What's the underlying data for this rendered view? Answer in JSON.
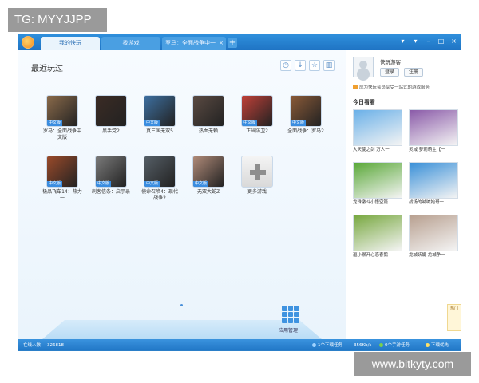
{
  "overlay": {
    "text": "TG: MYYJJPP"
  },
  "watermark": {
    "text": "www.bitkyty.com"
  },
  "titlebar": {
    "tabs": [
      {
        "label": "我的快玩"
      },
      {
        "label": "找游戏"
      },
      {
        "label": "罗马：全面战争中一"
      }
    ],
    "tab_close": "×",
    "tab_plus": "+"
  },
  "main": {
    "title": "最近玩过",
    "games": [
      {
        "name": "罗马：全面战争中文版",
        "tag": "中文版",
        "color": "#8a6a4a"
      },
      {
        "name": "黑手党2",
        "tag": "",
        "color": "#3b2b24"
      },
      {
        "name": "真三国无双5",
        "tag": "中文版",
        "color": "#3d6fa0"
      },
      {
        "name": "热血无赖",
        "tag": "",
        "color": "#5a4a42"
      },
      {
        "name": "正当防卫2",
        "tag": "中文版",
        "color": "#c04038"
      },
      {
        "name": "全面战争：罗马2",
        "tag": "中文版",
        "color": "#8a5a38"
      },
      {
        "name": "极品飞车14：热力一",
        "tag": "中文版",
        "color": "#9a4a2a"
      },
      {
        "name": "刺客信条：启示录",
        "tag": "中文版",
        "color": "#7a7a7a"
      },
      {
        "name": "使命召唤4：现代战争2",
        "tag": "中文版",
        "color": "#555e66"
      },
      {
        "name": "无双大蛇Z",
        "tag": "中文版",
        "color": "#b08a78"
      }
    ],
    "more_label": "更多游戏",
    "app_manager_label": "应用管理"
  },
  "side": {
    "user_name": "快玩游客",
    "login_label": "登录",
    "register_label": "注册",
    "promo_text": "成为快玩会员享受一站式的游戏服务",
    "today_title": "今日看看",
    "recommendations": [
      {
        "caption": "大天使之剑  万人一",
        "color": "#6ab0e8"
      },
      {
        "caption": "灵域  萝莉萌主【一",
        "color": "#8a5aa8"
      },
      {
        "caption": "龙珠激斗小悟空篇",
        "color": "#5aa838"
      },
      {
        "caption": "战场的呐喊始哥一",
        "color": "#3a90d8"
      },
      {
        "caption": "逗小猴开心恋春鹅",
        "color": "#78a840"
      },
      {
        "caption": "龙城妖婕  龙城争一",
        "color": "#b8a090"
      }
    ],
    "side_tag": "热门"
  },
  "statusbar": {
    "online_label": "在线人数：",
    "online_count": "326818",
    "download_task": "1个下载任务",
    "speed": "356Kb/s",
    "mobile_task": "0个手游任务",
    "accelerate": "下载优先"
  },
  "colors": {
    "titlebar": "#2f8fdc",
    "statusbar": "#1f74c4",
    "accent": "#3a8de0"
  }
}
